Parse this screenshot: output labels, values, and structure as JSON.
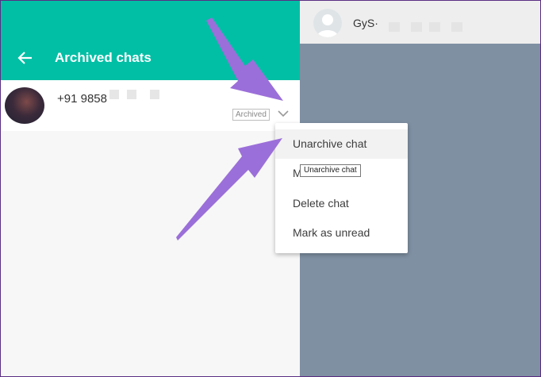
{
  "sidebar": {
    "title": "Archived chats",
    "chats": [
      {
        "name": "+91 9858",
        "badge": "Archived"
      }
    ]
  },
  "conversation": {
    "contact_name": "GyS·"
  },
  "context_menu": {
    "items": [
      "Unarchive chat",
      "M",
      "Delete chat",
      "Mark as unread"
    ],
    "tooltip": "Unarchive chat"
  },
  "colors": {
    "header": "#00bfa5",
    "conversation_bg": "#7f90a3",
    "annotation_arrow": "#9b6fd9"
  }
}
